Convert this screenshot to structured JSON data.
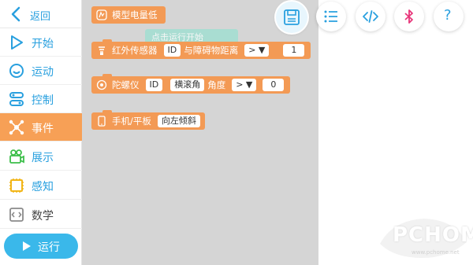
{
  "sidebar": {
    "back_label": "返回",
    "items": [
      {
        "label": "开始",
        "icon": "play-outline-icon"
      },
      {
        "label": "运动",
        "icon": "smile-icon"
      },
      {
        "label": "控制",
        "icon": "toggle-icon"
      },
      {
        "label": "事件",
        "icon": "network-icon",
        "active": true
      },
      {
        "label": "展示",
        "icon": "camera-icon"
      },
      {
        "label": "感知",
        "icon": "sensor-icon"
      },
      {
        "label": "数学",
        "icon": "code-icon"
      }
    ],
    "run_label": "运行"
  },
  "flyout": {
    "ghost_label": "点击运行开始",
    "blocks": [
      {
        "icon": "battery-icon",
        "parts": [
          "模型电量低"
        ]
      },
      {
        "icon": "infrared-icon",
        "label": "红外传感器",
        "id_slot": "ID",
        "middle": "与障碍物距离",
        "op": "> ▼",
        "value": "1"
      },
      {
        "icon": "gyro-icon",
        "label": "陀螺仪",
        "id_slot": "ID",
        "axis": "横滚角",
        "middle": "角度",
        "op": "> ▼",
        "value": "0"
      },
      {
        "icon": "phone-icon",
        "label": "手机/平板",
        "orientation": "向左倾斜"
      }
    ]
  },
  "toolbar": {
    "buttons": [
      "save-icon",
      "list-icon",
      "code-icon",
      "bluetooth-icon",
      "help-icon"
    ],
    "help_label": "?"
  },
  "watermark": {
    "text": "PCHOME",
    "sub": "www.pchome.net"
  },
  "colors": {
    "accent": "#29a0df",
    "event": "#f39a55",
    "run": "#3ab8ea"
  }
}
